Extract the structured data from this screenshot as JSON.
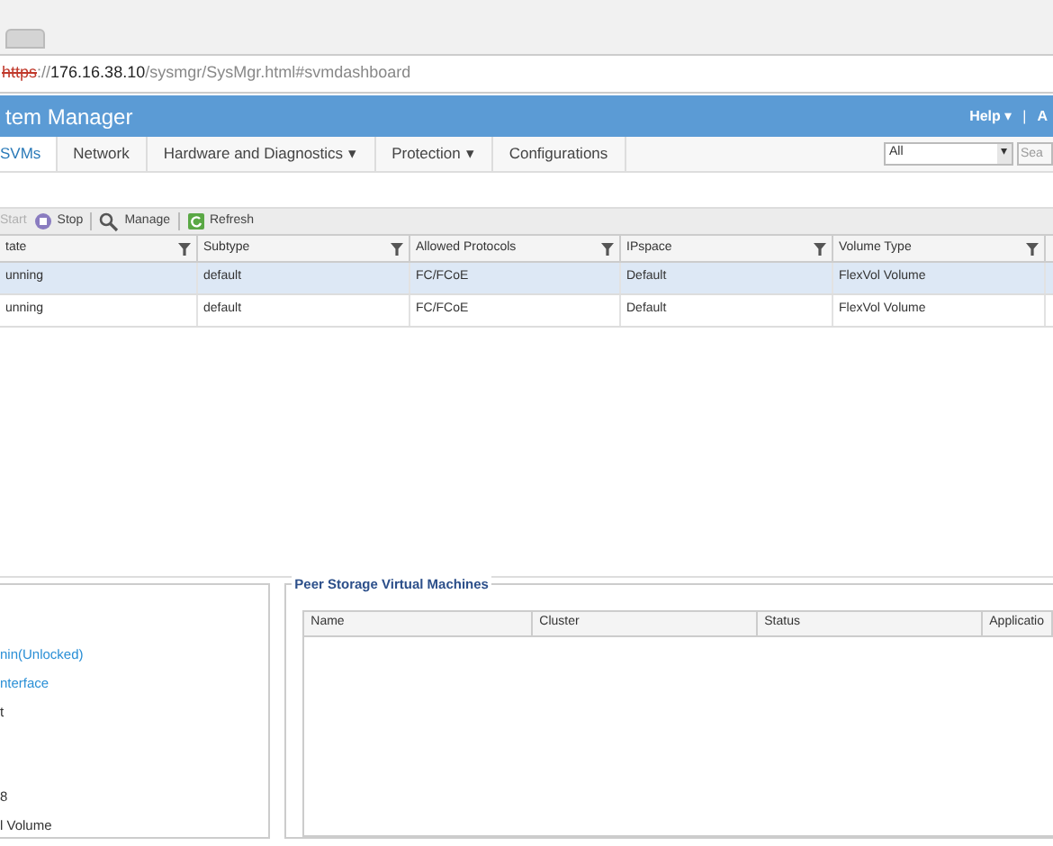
{
  "browser": {
    "url_scheme": "https",
    "url_sep": "://",
    "url_host": "176.16.38.10",
    "url_path": "/sysmgr/SysMgr.html#svmdashboard"
  },
  "header": {
    "title": "tem Manager",
    "help": "Help",
    "help_caret": "▾",
    "divider": "|",
    "user": "A"
  },
  "nav": [
    {
      "label": "SVMs",
      "selected": true,
      "caret": false
    },
    {
      "label": "Network",
      "selected": false,
      "caret": false
    },
    {
      "label": "Hardware and Diagnostics",
      "selected": false,
      "caret": true
    },
    {
      "label": "Protection",
      "selected": false,
      "caret": true
    },
    {
      "label": "Configurations",
      "selected": false,
      "caret": false
    }
  ],
  "caret": "▾",
  "filter": {
    "value": "All",
    "search_placeholder": "Sea"
  },
  "toolbar": [
    {
      "label": "Start",
      "kind": "start",
      "disabled": true
    },
    {
      "label": "Stop",
      "kind": "stop",
      "disabled": false
    },
    {
      "label": "Manage",
      "kind": "manage",
      "disabled": false
    },
    {
      "label": "Refresh",
      "kind": "refresh",
      "disabled": false
    }
  ],
  "table": {
    "columns": [
      "tate",
      "Subtype",
      "Allowed Protocols",
      "IPspace",
      "Volume Type"
    ],
    "rows": [
      {
        "selected": true,
        "cells": [
          "unning",
          "default",
          "FC/FCoE",
          "Default",
          "FlexVol Volume"
        ]
      },
      {
        "selected": false,
        "cells": [
          "unning",
          "default",
          "FC/FCoE",
          "Default",
          "FlexVol Volume"
        ]
      }
    ]
  },
  "details": [
    {
      "text": "nin(Unlocked)",
      "kind": "link"
    },
    {
      "text": "nterface",
      "kind": "link"
    },
    {
      "text": "t",
      "kind": "plain"
    },
    {
      "kind": "gap"
    },
    {
      "kind": "gap"
    },
    {
      "text": "8",
      "kind": "plain"
    },
    {
      "text": "l Volume",
      "kind": "plain"
    }
  ],
  "peer": {
    "title": "Peer Storage Virtual Machines",
    "columns": [
      "Name",
      "Cluster",
      "Status",
      "Applicatio"
    ]
  }
}
